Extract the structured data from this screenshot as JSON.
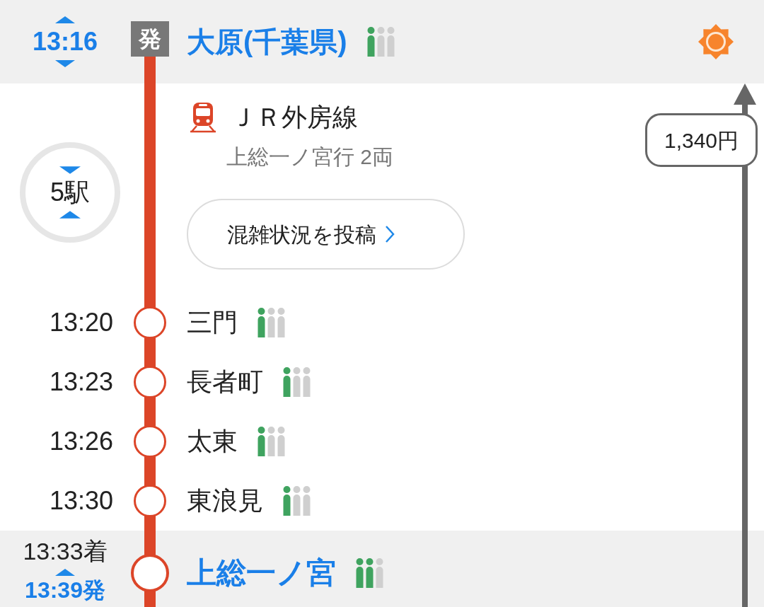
{
  "departure": {
    "time": "13:16",
    "badge": "発",
    "station": "大原(千葉県)",
    "crowd": [
      {
        "filled": true
      },
      {
        "filled": false
      },
      {
        "filled": false
      }
    ]
  },
  "weather": {
    "kind": "sunny"
  },
  "segment": {
    "line_name": "ＪＲ外房線",
    "destination": "上総一ノ宮行 2両",
    "stop_count": "5駅",
    "report_button": "混雑状況を投稿",
    "fare": "1,340円"
  },
  "stops": [
    {
      "time": "13:20",
      "station": "三門",
      "crowd": [
        {
          "filled": true
        },
        {
          "filled": false
        },
        {
          "filled": false
        }
      ]
    },
    {
      "time": "13:23",
      "station": "長者町",
      "crowd": [
        {
          "filled": true
        },
        {
          "filled": false
        },
        {
          "filled": false
        }
      ]
    },
    {
      "time": "13:26",
      "station": "太東",
      "crowd": [
        {
          "filled": true
        },
        {
          "filled": false
        },
        {
          "filled": false
        }
      ]
    },
    {
      "time": "13:30",
      "station": "東浪見",
      "crowd": [
        {
          "filled": true
        },
        {
          "filled": false
        },
        {
          "filled": false
        }
      ]
    }
  ],
  "arrival": {
    "arrival_time": "13:33着",
    "departure_time": "13:39発",
    "station": "上総一ノ宮",
    "crowd": [
      {
        "filled": true
      },
      {
        "filled": true
      },
      {
        "filled": false
      }
    ]
  }
}
